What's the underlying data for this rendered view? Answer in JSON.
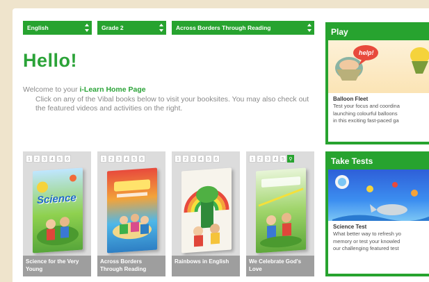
{
  "dropdowns": [
    {
      "value": "English"
    },
    {
      "value": "Grade 2"
    },
    {
      "value": "Across Borders Through Reading"
    }
  ],
  "welcome": {
    "greeting": "Hello!",
    "line1_prefix": "Welcome to your ",
    "line1_brand": "i-Learn Home Page",
    "line2": "Click on any of the Vibal books below to visit your booksites. You may also check out the featured videos and activities on the right."
  },
  "books": [
    {
      "pages": [
        "1",
        "2",
        "3",
        "4",
        "5",
        "6"
      ],
      "highlight": -1,
      "cover_title": "Science",
      "label": "Science for the Very Young",
      "cover_color": "#8fd14f"
    },
    {
      "pages": [
        "1",
        "2",
        "3",
        "4",
        "5",
        "6"
      ],
      "highlight": -1,
      "cover_title": "",
      "label": "Across Borders Through Reading",
      "cover_color": "#e84a3c"
    },
    {
      "pages": [
        "1",
        "2",
        "3",
        "4",
        "5",
        "6"
      ],
      "highlight": -1,
      "cover_title": "",
      "label": "Rainbows in English",
      "cover_color": "#f5f2ea"
    },
    {
      "pages": [
        "1",
        "2",
        "3",
        "4",
        "5"
      ],
      "highlight": 5,
      "cover_title": "",
      "label": "We Celebrate God's Love",
      "cover_color": "#7ec24a"
    }
  ],
  "panels": {
    "play": {
      "title": "Play",
      "bubble": "help!",
      "name": "Balloon Fleet",
      "desc": [
        "Test your focus and coordina",
        "launching colourful balloons",
        "in this exciting fast-paced ga"
      ]
    },
    "tests": {
      "title": "Take Tests",
      "name": "Science Test",
      "desc": [
        "What better way to refresh yo",
        "memory or test your knowled",
        "our challenging featured test"
      ]
    }
  },
  "colors": {
    "accent": "#27a32f",
    "background": "#efe4cc",
    "book_label": "#9e9e9e"
  }
}
